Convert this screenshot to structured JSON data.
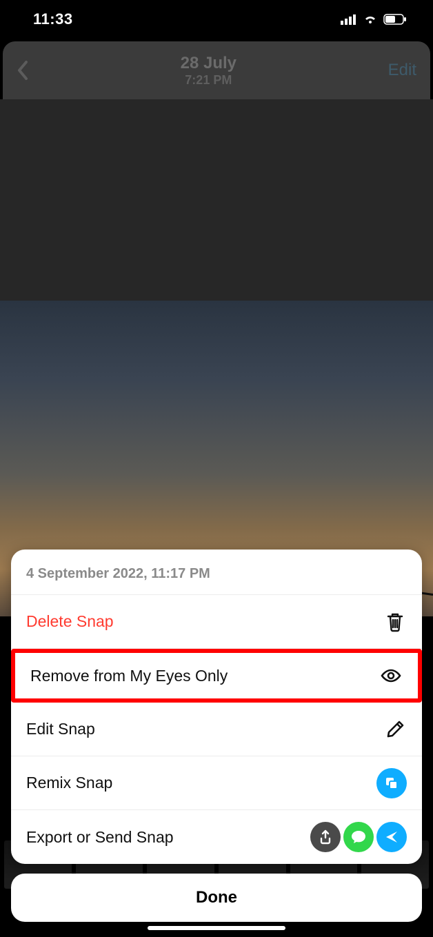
{
  "status": {
    "time": "11:33"
  },
  "header": {
    "date": "28 July",
    "time": "7:21 PM",
    "edit": "Edit"
  },
  "sheet": {
    "timestamp": "4 September 2022, 11:17 PM",
    "rows": {
      "delete": "Delete Snap",
      "remove": "Remove from My Eyes Only",
      "edit": "Edit Snap",
      "remix": "Remix Snap",
      "export": "Export or Send Snap"
    }
  },
  "done": "Done"
}
